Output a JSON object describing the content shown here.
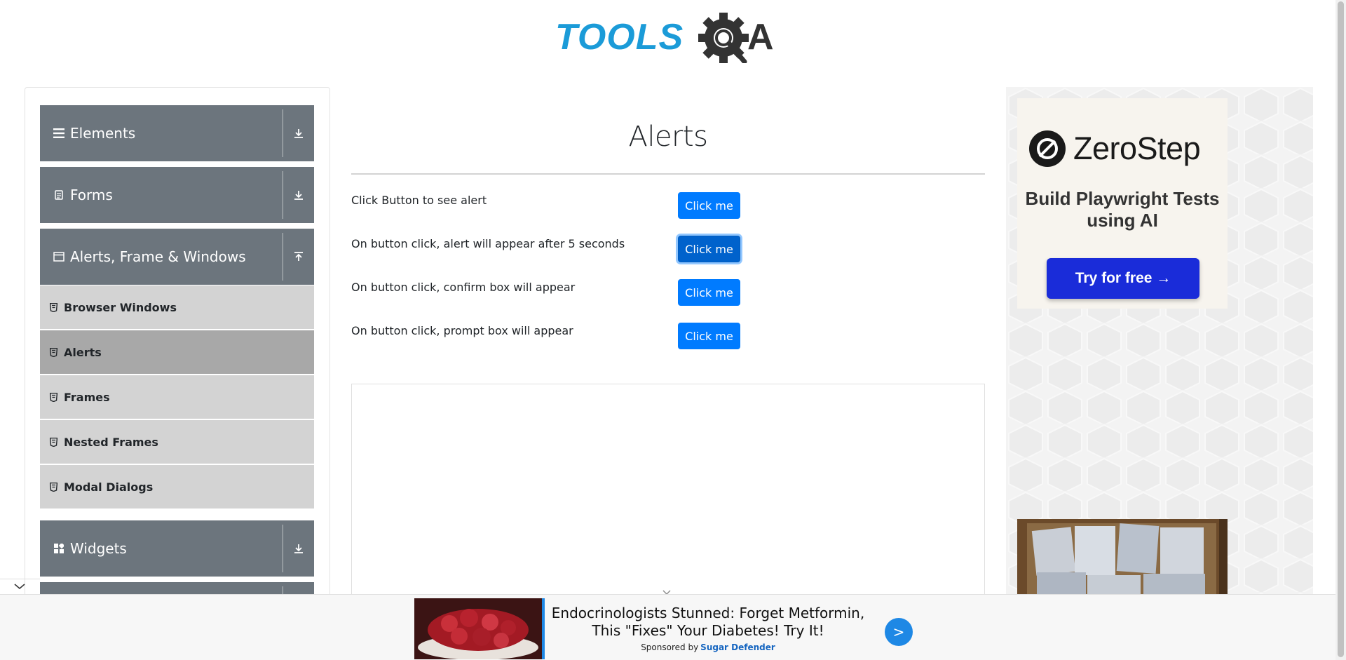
{
  "header": {
    "logo_text_left": "TOOLS",
    "logo_text_right": "A"
  },
  "sidebar": {
    "groups": [
      {
        "label": "Elements",
        "icon": "hamburger-icon",
        "state": "collapsed"
      },
      {
        "label": "Forms",
        "icon": "document-icon",
        "state": "collapsed"
      },
      {
        "label": "Alerts, Frame & Windows",
        "icon": "window-icon",
        "state": "expanded"
      },
      {
        "label": "Widgets",
        "icon": "grid-icon",
        "state": "collapsed"
      }
    ],
    "sub_items": [
      {
        "label": "Browser Windows",
        "active": false
      },
      {
        "label": "Alerts",
        "active": true
      },
      {
        "label": "Frames",
        "active": false
      },
      {
        "label": "Nested Frames",
        "active": false
      },
      {
        "label": "Modal Dialogs",
        "active": false
      }
    ]
  },
  "main": {
    "title": "Alerts",
    "rows": [
      {
        "label": "Click Button to see alert",
        "button": "Click me"
      },
      {
        "label": "On button click, alert will appear after 5 seconds",
        "button": "Click me"
      },
      {
        "label": "On button click, confirm box will appear",
        "button": "Click me"
      },
      {
        "label": "On button click, prompt box will appear",
        "button": "Click me"
      }
    ]
  },
  "right_ad": {
    "brand": "ZeroStep",
    "tagline": "Build Playwright Tests using AI",
    "cta": "Try for free →"
  },
  "bottom_ad": {
    "headline": "Endocrinologists Stunned: Forget Metformin, This \"Fixes\" Your Diabetes! Try It!",
    "sponsored_by": "Sponsored by",
    "sponsor": "Sugar Defender",
    "go_label": ">"
  },
  "colors": {
    "accent": "#007bff",
    "sidebar_header": "#6c757d",
    "sub_item": "#d3d3d3",
    "sub_item_active": "#a8a8a8",
    "logo_blue": "#1b9bd8",
    "logo_dark": "#333333"
  }
}
